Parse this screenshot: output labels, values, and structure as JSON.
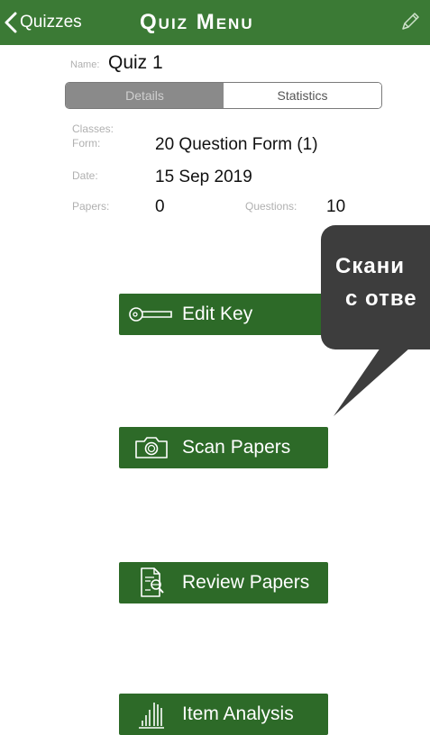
{
  "navbar": {
    "back_label": "Quizzes",
    "title": "Quiz Menu",
    "edit_icon": "pencil-icon"
  },
  "info": {
    "name_label": "Name:",
    "name_value": "Quiz 1",
    "classes_label": "Classes:",
    "form_label": "Form:",
    "form_value": "20 Question Form (1)",
    "date_label": "Date:",
    "date_value": "15 Sep 2019",
    "papers_label": "Papers:",
    "papers_value": "0",
    "questions_label": "Questions:",
    "questions_value": "10"
  },
  "segment": {
    "details_label": "Details",
    "statistics_label": "Statistics",
    "selected": "Details"
  },
  "actions": {
    "edit_key": "Edit Key",
    "scan_papers": "Scan Papers",
    "review_papers": "Review Papers",
    "item_analysis": "Item Analysis"
  },
  "tooltip": {
    "line1": "Скани",
    "line2": "с отве"
  },
  "colors": {
    "navbar": "#3b7a35",
    "button": "#2d6a28",
    "tooltip": "#3d3d3d"
  }
}
